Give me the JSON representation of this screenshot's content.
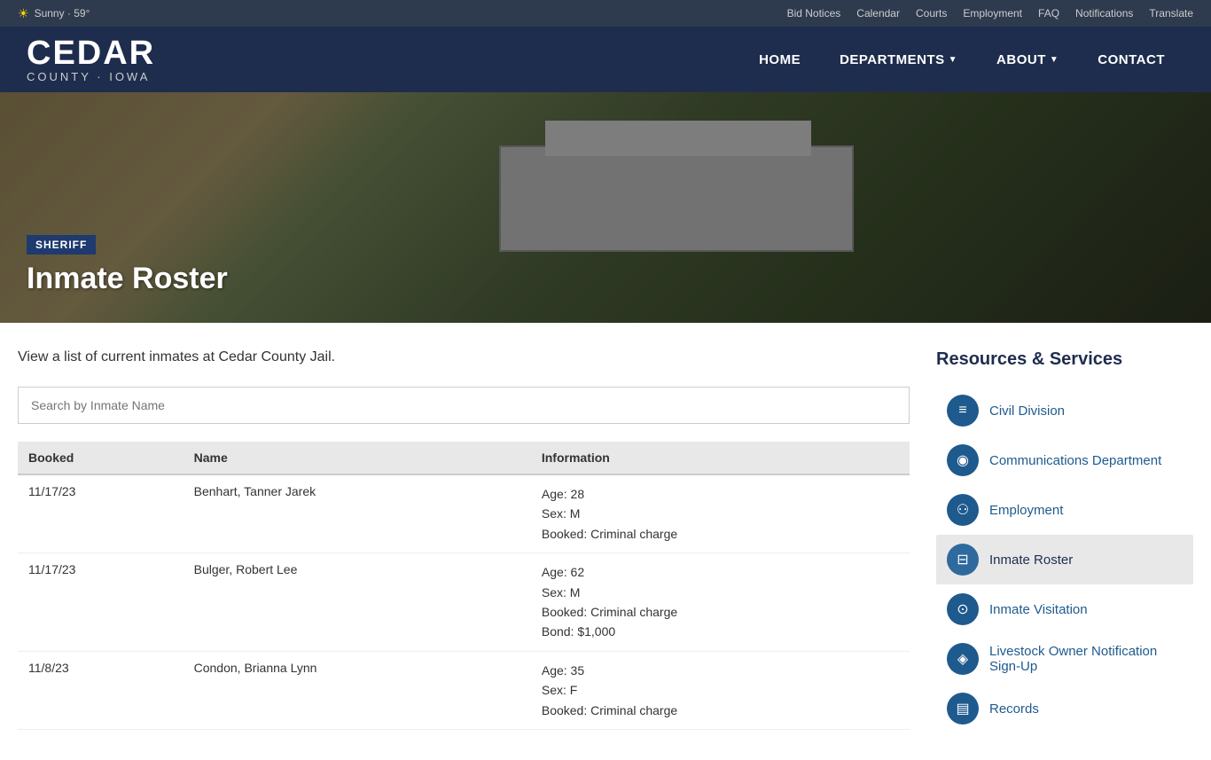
{
  "topbar": {
    "weather": "Sunny · 59°",
    "links": [
      {
        "label": "Bid Notices",
        "href": "#"
      },
      {
        "label": "Calendar",
        "href": "#"
      },
      {
        "label": "Courts",
        "href": "#"
      },
      {
        "label": "Employment",
        "href": "#"
      },
      {
        "label": "FAQ",
        "href": "#"
      },
      {
        "label": "Notifications",
        "href": "#"
      },
      {
        "label": "Translate",
        "href": "#"
      }
    ]
  },
  "header": {
    "logo_title": "CEDAR",
    "logo_sub": "COUNTY · IOWA",
    "nav": [
      {
        "label": "HOME",
        "dropdown": false
      },
      {
        "label": "DEPARTMENTS",
        "dropdown": true
      },
      {
        "label": "ABOUT",
        "dropdown": true
      },
      {
        "label": "CONTACT",
        "dropdown": false
      }
    ]
  },
  "hero": {
    "breadcrumb": "SHERIFF",
    "title": "Inmate Roster"
  },
  "page": {
    "description": "View a list of current inmates at Cedar County Jail.",
    "search_placeholder": "Search by Inmate Name"
  },
  "table": {
    "headers": [
      "Booked",
      "Name",
      "Information"
    ],
    "rows": [
      {
        "booked": "11/17/23",
        "name": "Benhart, Tanner Jarek",
        "info": [
          "Age: 28",
          "Sex: M",
          "Booked: Criminal charge"
        ]
      },
      {
        "booked": "11/17/23",
        "name": "Bulger, Robert Lee",
        "info": [
          "Age: 62",
          "Sex: M",
          "Booked: Criminal charge",
          "Bond: $1,000"
        ]
      },
      {
        "booked": "11/8/23",
        "name": "Condon, Brianna Lynn",
        "info": [
          "Age: 35",
          "Sex: F",
          "Booked: Criminal charge"
        ]
      }
    ]
  },
  "sidebar": {
    "title": "Resources & Services",
    "items": [
      {
        "label": "Civil Division",
        "icon": "📄",
        "active": false
      },
      {
        "label": "Communications Department",
        "icon": "📡",
        "active": false
      },
      {
        "label": "Employment",
        "icon": "👥",
        "active": false
      },
      {
        "label": "Inmate Roster",
        "icon": "🔒",
        "active": true
      },
      {
        "label": "Inmate Visitation",
        "icon": "👤",
        "active": false
      },
      {
        "label": "Livestock Owner Notification Sign-Up",
        "icon": "🐄",
        "active": false
      },
      {
        "label": "Records",
        "icon": "📁",
        "active": false
      }
    ]
  }
}
